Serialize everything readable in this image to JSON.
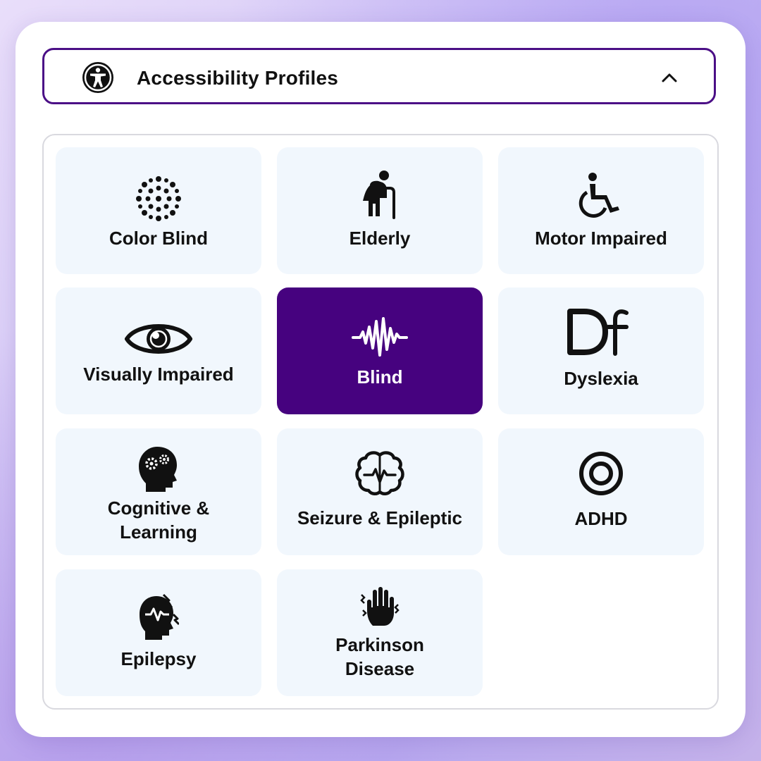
{
  "header": {
    "title": "Accessibility Profiles",
    "icon": "accessibility-person-icon",
    "toggle_icon": "chevron-up-icon"
  },
  "colors": {
    "accent": "#46027f",
    "header_border": "#4b0f86",
    "tile_bg": "#f1f7fd",
    "panel_border": "#d9d9df"
  },
  "profiles": [
    {
      "label": "Color Blind",
      "icon": "dot-pattern-icon",
      "active": false
    },
    {
      "label": "Elderly",
      "icon": "elderly-person-icon",
      "active": false
    },
    {
      "label": "Motor Impaired",
      "icon": "wheelchair-icon",
      "active": false
    },
    {
      "label": "Visually Impaired",
      "icon": "eye-icon",
      "active": false
    },
    {
      "label": "Blind",
      "icon": "soundwave-icon",
      "active": true
    },
    {
      "label": "Dyslexia",
      "icon": "dyslexia-df-icon",
      "icon_text": "Df",
      "active": false
    },
    {
      "label_line1": "Cognitive &",
      "label_line2": "Learning",
      "icon": "head-gears-icon",
      "active": false
    },
    {
      "label": "Seizure & Epileptic",
      "icon": "brain-pulse-icon",
      "active": false
    },
    {
      "label": "ADHD",
      "icon": "target-icon",
      "active": false
    },
    {
      "label": "Epilepsy",
      "icon": "head-lightning-icon",
      "active": false
    },
    {
      "label_line1": "Parkinson",
      "label_line2": "Disease",
      "icon": "shaking-hand-icon",
      "active": false
    }
  ]
}
